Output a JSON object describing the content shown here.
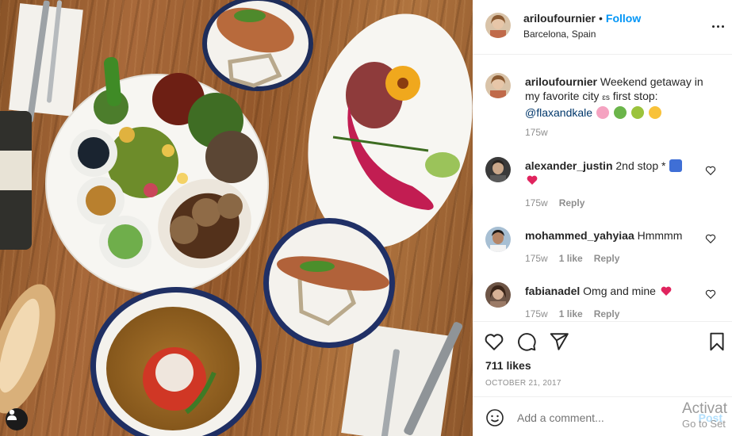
{
  "post": {
    "author": "ariloufournier",
    "follow_label": "Follow",
    "dot": "•",
    "location": "Barcelona, Spain"
  },
  "caption": {
    "username": "ariloufournier",
    "text": "Weekend getaway in my favorite city",
    "text_tail": "first stop:",
    "small_mark": "ɛs",
    "mention": "@flaxandkale",
    "time": "175w"
  },
  "comments": [
    {
      "username": "alexander_justin",
      "text": "2nd stop *",
      "time": "175w",
      "likes": "",
      "reply": "Reply"
    },
    {
      "username": "mohammed_yahyiaa",
      "text": "Hmmmm",
      "time": "175w",
      "likes": "1 like",
      "reply": "Reply"
    },
    {
      "username": "fabianadel",
      "text": "Omg and mine",
      "time": "175w",
      "likes": "1 like",
      "reply": "Reply"
    }
  ],
  "stats": {
    "likes": "711 likes",
    "date": "OCTOBER 21, 2017"
  },
  "compose": {
    "placeholder": "Add a comment...",
    "post_label": "Post"
  },
  "watermark": {
    "line1": "Activat",
    "line2": "Go to Set"
  },
  "icons": {
    "like": "heart-icon",
    "comment": "comment-icon",
    "share": "paper-plane-icon",
    "save": "bookmark-icon",
    "emoji": "smiley-icon",
    "more": "more-dots-icon"
  },
  "colors": {
    "follow": "#0095f6",
    "link": "#00376b",
    "muted": "#8e8e8e",
    "heart": "#ed4956"
  }
}
